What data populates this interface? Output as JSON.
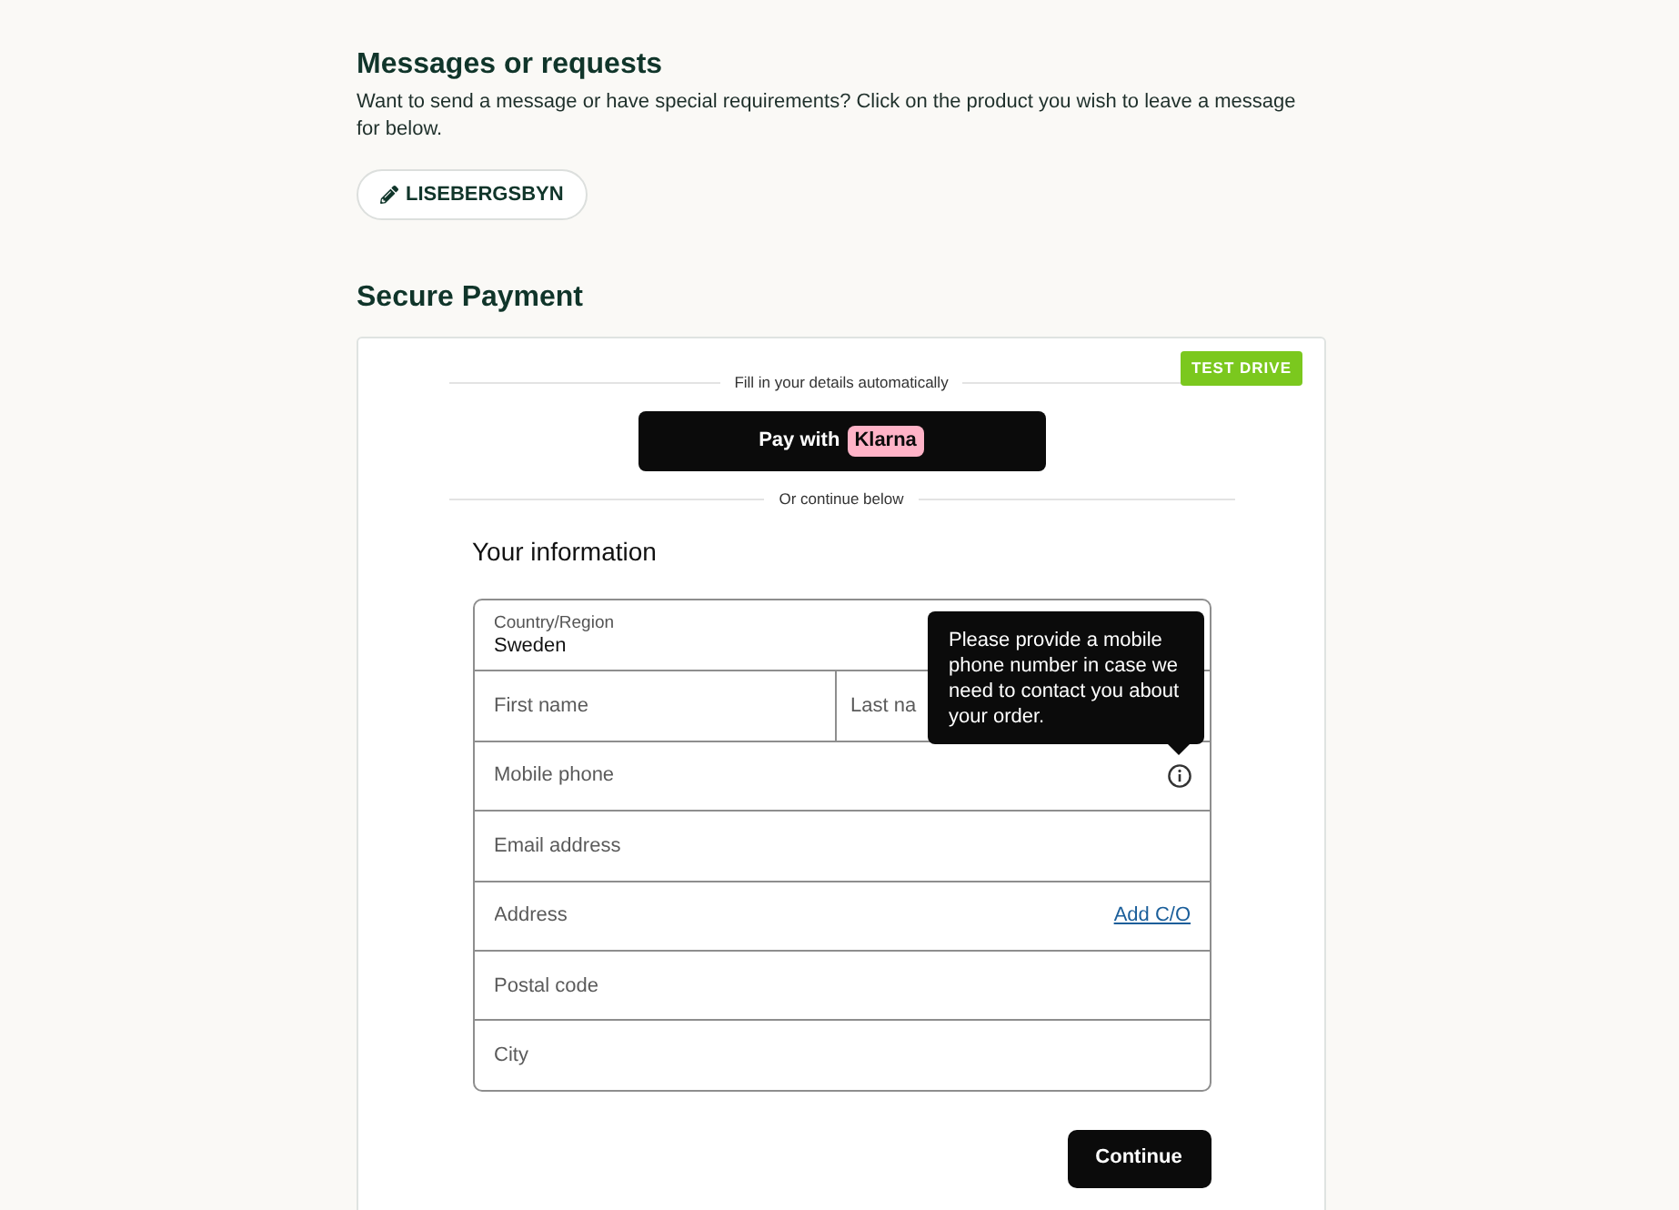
{
  "messages": {
    "title": "Messages or requests",
    "description": "Want to send a message or have special requirements? Click on the product you wish to leave a message for below.",
    "product_button": "LISEBERGSBYN"
  },
  "payment": {
    "title": "Secure Payment",
    "badge": "TEST DRIVE",
    "autofill_divider": "Fill in your details automatically",
    "klarna_button": {
      "label": "Pay with",
      "logo": "Klarna"
    },
    "continue_divider": "Or continue below",
    "form": {
      "title": "Your information",
      "rows": [
        [
          {
            "kind": "select",
            "label": "Country/Region",
            "value": "Sweden"
          }
        ],
        [
          {
            "kind": "text",
            "placeholder": "First name"
          },
          {
            "kind": "text",
            "placeholder": "Last na"
          }
        ],
        [
          {
            "kind": "text",
            "placeholder": "Mobile phone",
            "tooltip": "Please provide a mobile phone number in case we need to contact you about your order."
          }
        ],
        [
          {
            "kind": "text",
            "placeholder": "Email address"
          }
        ],
        [
          {
            "kind": "text",
            "placeholder": "Address",
            "link": "Add C/O"
          }
        ],
        [
          {
            "kind": "text",
            "placeholder": "Postal code"
          }
        ],
        [
          {
            "kind": "text",
            "placeholder": "City"
          }
        ]
      ]
    },
    "continue_button": "Continue"
  }
}
